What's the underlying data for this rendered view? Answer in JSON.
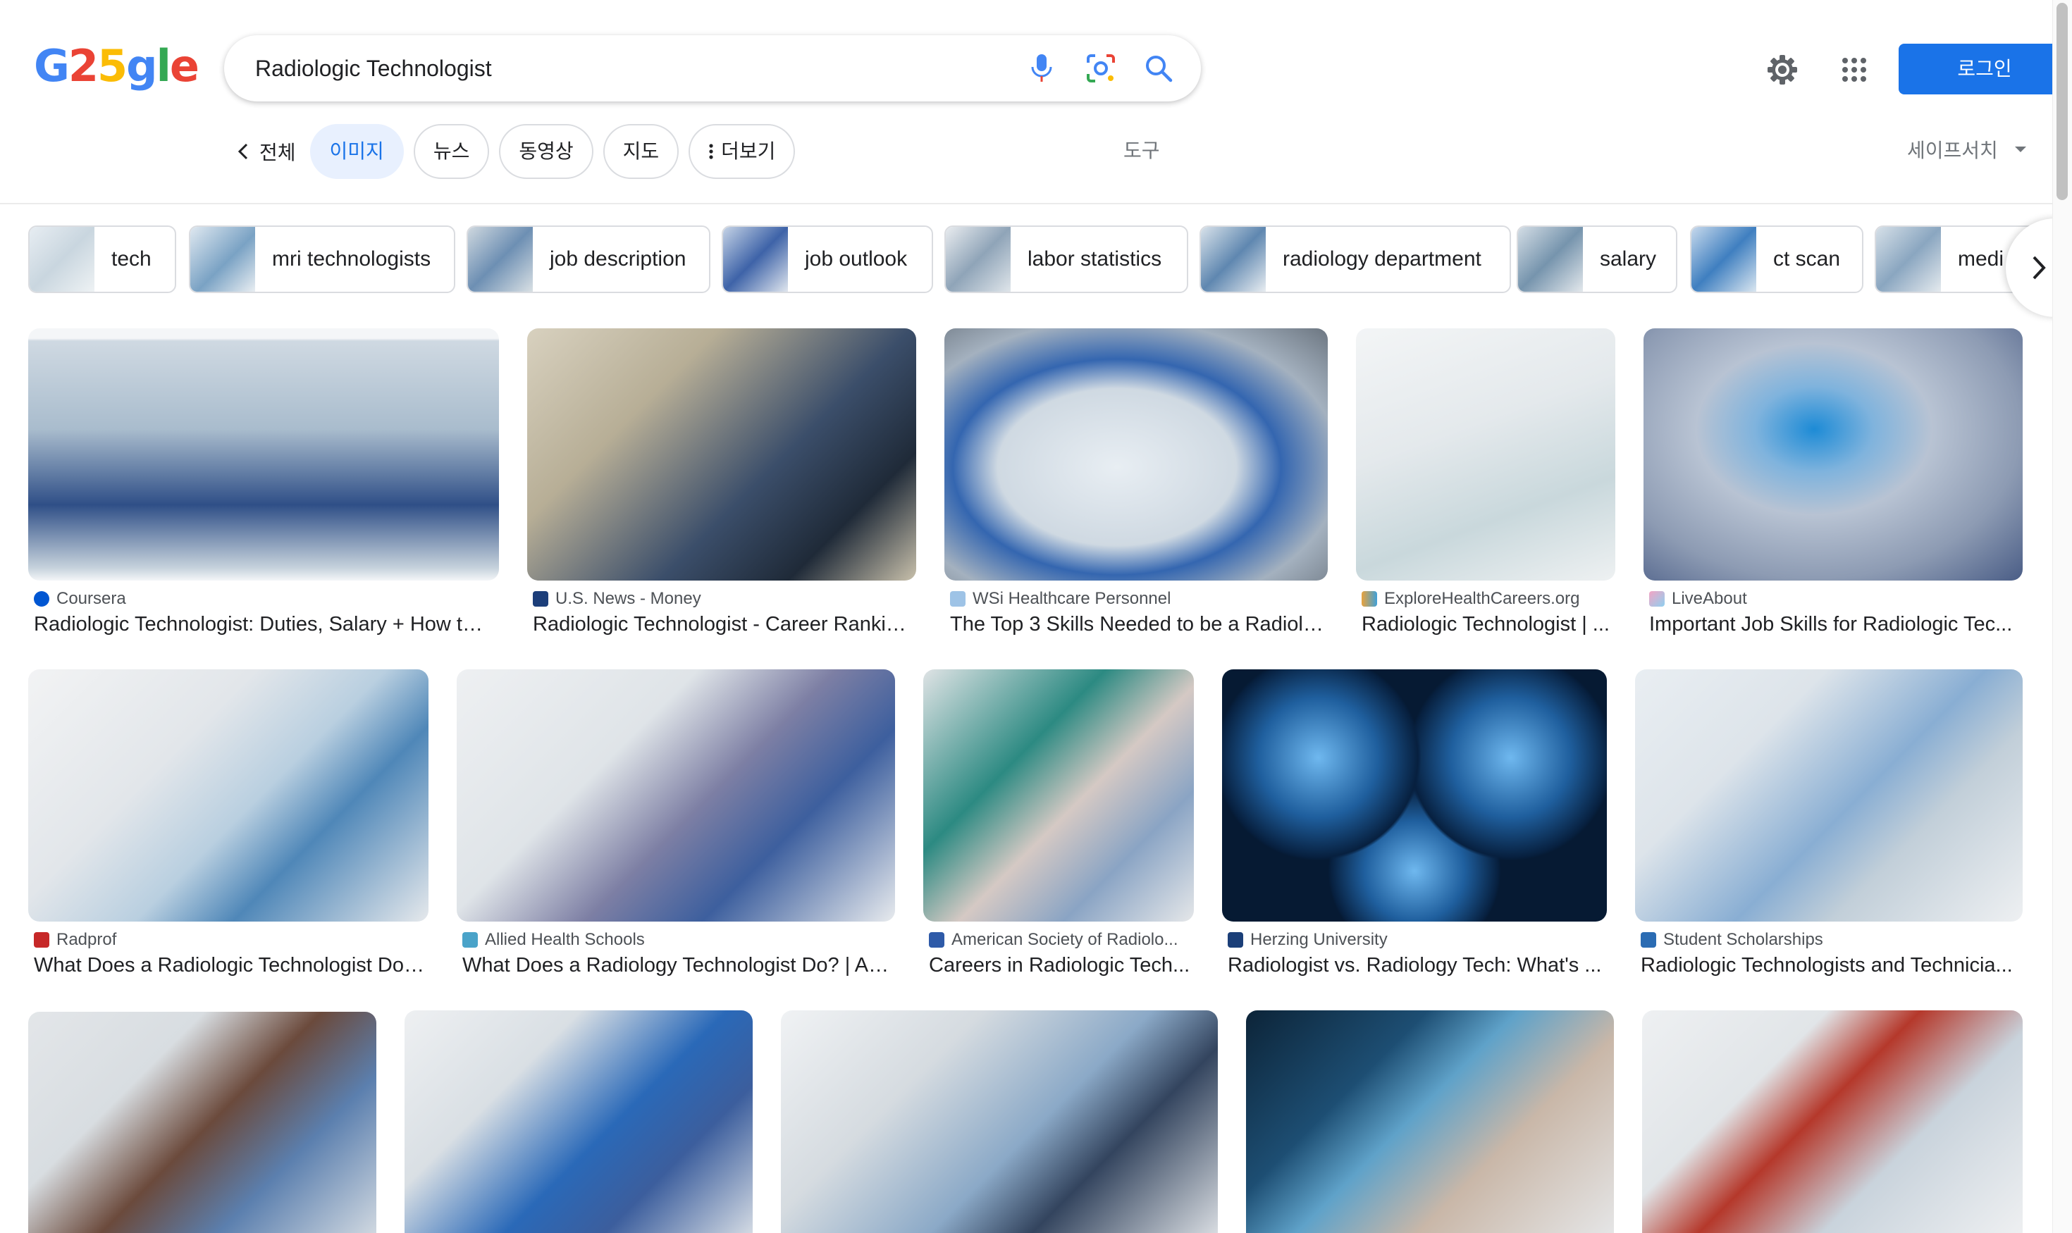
{
  "header": {
    "logo_letters": [
      "G",
      "2",
      "5",
      "g",
      "l",
      "e"
    ],
    "search_query": "Radiologic Technologist",
    "login_label": "로그인"
  },
  "tabs": {
    "back_label": "전체",
    "items": [
      "이미지",
      "뉴스",
      "동영상",
      "지도",
      "더보기"
    ],
    "tools_label": "도구",
    "safesearch_label": "세이프서치"
  },
  "chips": [
    "tech",
    "mri technologists",
    "job description",
    "job outlook",
    "labor statistics",
    "radiology department",
    "salary",
    "ct scan",
    "medi"
  ],
  "results": [
    {
      "source": "Coursera",
      "title": "Radiologic Technologist: Duties, Salary + How to ..."
    },
    {
      "source": "U.S. News - Money",
      "title": "Radiologic Technologist - Career Rankin..."
    },
    {
      "source": "WSi Healthcare Personnel",
      "title": "The Top 3 Skills Needed to be a Radiolo..."
    },
    {
      "source": "ExploreHealthCareers.org",
      "title": "Radiologic Technologist | ..."
    },
    {
      "source": "LiveAbout",
      "title": "Important Job Skills for Radiologic Tec..."
    },
    {
      "source": "Radprof",
      "title": "What Does a Radiologic Technologist Do?..."
    },
    {
      "source": "Allied Health Schools",
      "title": "What Does a Radiology Technologist Do? | All ..."
    },
    {
      "source": "American Society of Radiolo...",
      "title": "Careers in Radiologic Tech..."
    },
    {
      "source": "Herzing University",
      "title": "Radiologist vs. Radiology Tech: What's ..."
    },
    {
      "source": "Student Scholarships",
      "title": "Radiologic Technologists and Technicia..."
    },
    {
      "source": "",
      "title": ""
    },
    {
      "source": "",
      "title": ""
    },
    {
      "source": "",
      "title": ""
    },
    {
      "source": "",
      "title": ""
    },
    {
      "source": "",
      "title": ""
    }
  ],
  "colors": {
    "accent": "#1a73e8",
    "active_tab_bg": "#e8f0fe",
    "border": "#dadce0",
    "muted_text": "#70757a"
  }
}
